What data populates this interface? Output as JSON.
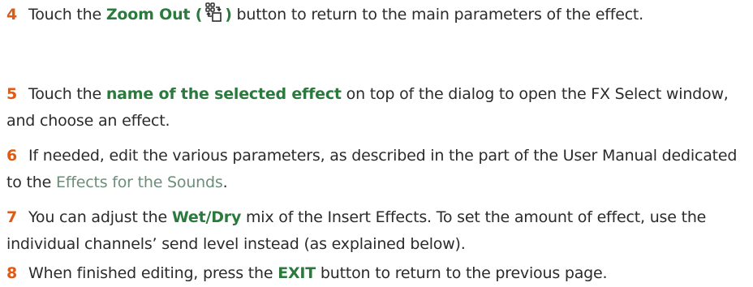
{
  "steps": [
    {
      "num": "4",
      "t1": "Touch the ",
      "hl1": "Zoom Out (",
      "icon": "zoom-out-icon",
      "hl2": ")",
      "t2": " button to return to the main parameters of the effect."
    },
    {
      "num": "5",
      "t1": "Touch the ",
      "hl1": "name of the selected effect",
      "t2": " on top of the dialog to open the FX Select window, and choose an effect."
    },
    {
      "num": "6",
      "t1": "If needed, edit the various parameters, as described in the part of the User Manual dedicated to the ",
      "link": "Effects for the Sounds",
      "t2": "."
    },
    {
      "num": "7",
      "t1": "You can adjust the ",
      "hl1": "Wet/Dry",
      "t2": " mix of the Insert Effects. To set the amount of effect, use the individual channels’ send level instead (as explained below)."
    },
    {
      "num": "8",
      "t1": "When finished editing, press the ",
      "hl1": "EXIT",
      "t2": " button to return to the previous page."
    }
  ],
  "colors": {
    "step_number": "#e05a14",
    "highlight": "#2b7a3d",
    "link": "#6b8e7a",
    "body_text": "#2b2b2b"
  }
}
